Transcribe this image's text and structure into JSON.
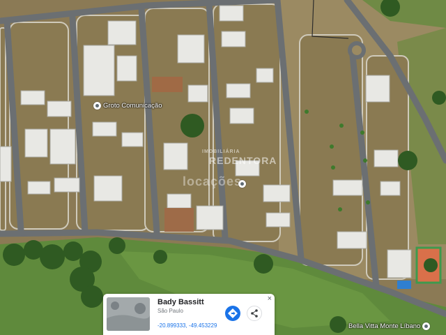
{
  "map": {
    "view_type": "satellite",
    "colors": {
      "dry_lot": "#8b7a55",
      "road": "#6b6f72",
      "curb": "#c7c4b8",
      "grass": "#5f8a3c",
      "tree": "#2f5a22",
      "roof": "#e8e8e4"
    }
  },
  "pois": [
    {
      "name": "Groto Comunicação"
    },
    {
      "name": "Bella Vitta Monte Líbano"
    }
  ],
  "watermark": {
    "line1": "IMOBILIÁRIA",
    "line2": "REDENTORA",
    "line3": "locações"
  },
  "place_card": {
    "title": "Bady Bassitt",
    "subtitle": "São Paulo",
    "coordinates": "-20.899333, -49.453229",
    "close_label": "×",
    "directions_icon": "directions-icon",
    "share_icon": "share-icon"
  }
}
